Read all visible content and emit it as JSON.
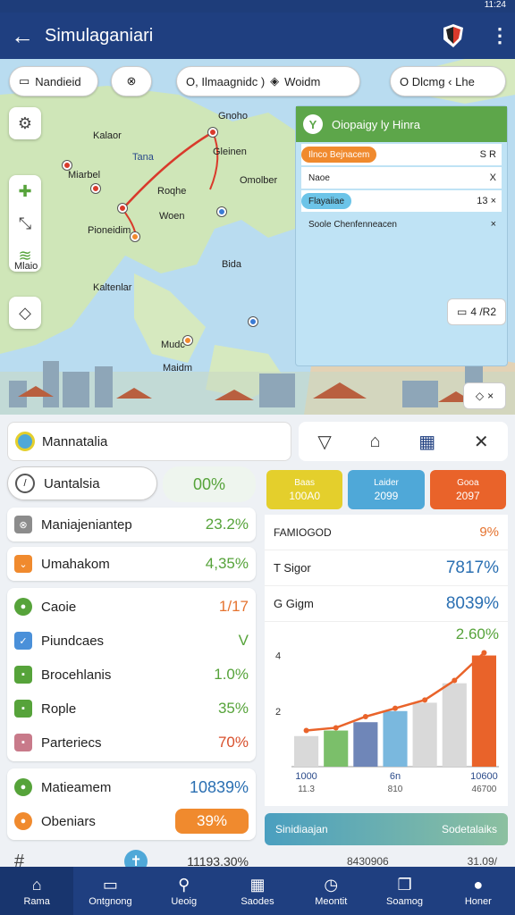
{
  "status": {
    "time": "11:24"
  },
  "appbar": {
    "title": "Simulaganiari"
  },
  "map": {
    "chips": [
      "Nandieid",
      "O, Ilmaagnidc  )",
      "Woidm",
      "O Dlcmg  ‹ Lhe"
    ],
    "labels": [
      "Kalaor",
      "Tana",
      "Gnoho",
      "Miarbel",
      "Gleinen",
      "Roqhe",
      "Omolber",
      "Woen",
      "Pioneidim",
      "Bida",
      "Mlaio",
      "Kaltenlar",
      "Mudc",
      "Maidm"
    ],
    "legend": {
      "title": "Oiopaigy ly Hinra",
      "rows": [
        {
          "tag": "Ilnco Bejnacem",
          "tag_color": "#f08a2e",
          "value": "S R"
        },
        {
          "tag": "Naoe",
          "tag_color": "#ffffff",
          "value": "X"
        },
        {
          "tag": "Flayaiiae",
          "tag_color": "#6cc4e8",
          "value": "13  ×"
        },
        {
          "tag": "Soole Chenfenneacen",
          "tag_color": "#bfe3f5",
          "value": "×"
        }
      ],
      "counter": "4 /R2"
    }
  },
  "toolbar": {
    "search_label": "Mannatalia"
  },
  "left": {
    "top": {
      "label": "Uantalsia",
      "value": "00%"
    },
    "rows": [
      {
        "label": "Maniajeniantep",
        "value": "23.2%",
        "color": "#56a33a",
        "icon_color": "#8c8c8c",
        "icon": "⊗"
      },
      {
        "label": "Umahakom",
        "value": "4,35%",
        "color": "#56a33a",
        "icon_color": "#f08a2e",
        "icon": "⌄"
      }
    ],
    "group": [
      {
        "label": "Caoie",
        "value": "1/17",
        "color": "#e5732f",
        "icon_color": "#56a33a",
        "icon": "●"
      },
      {
        "label": "Piundcaes",
        "value": "V",
        "color": "#56a33a",
        "icon_color": "#4a90d9",
        "icon": "✓"
      },
      {
        "label": "Brocehlanis",
        "value": "1.0%",
        "color": "#56a33a",
        "icon_color": "#56a33a",
        "icon": "▪"
      },
      {
        "label": "Rople",
        "value": "35%",
        "color": "#56a33a",
        "icon_color": "#56a33a",
        "icon": "▪"
      },
      {
        "label": "Parteriecs",
        "value": "70%",
        "color": "#d8502c",
        "icon_color": "#c87a8a",
        "icon": "▪"
      }
    ],
    "bottom": [
      {
        "label": "Matieamem",
        "value": "10839%",
        "color": "#2a6fb2",
        "icon_color": "#56a33a"
      },
      {
        "label": "Obeniars",
        "value": "39%",
        "color": "#ffffff",
        "icon_color": "#f08a2e"
      }
    ],
    "footer": {
      "value": "11193.30%"
    }
  },
  "right": {
    "tiles": [
      {
        "label": "Baas",
        "value": "100A0",
        "color": "#e4cf2c"
      },
      {
        "label": "Laider",
        "value": "2099",
        "color": "#4fa8d8"
      },
      {
        "label": "Gooa",
        "value": "2097",
        "color": "#e9632a"
      }
    ],
    "rows": [
      {
        "label": "FAMIOGOD",
        "value": "9%",
        "color": "#e5732f"
      },
      {
        "label": "T Sigor",
        "value": "7817%",
        "color": "#2a6fb2"
      },
      {
        "label": "G Gigm",
        "value": "8039%",
        "color": "#2a6fb2"
      }
    ],
    "chart_annotation": "2.60%",
    "footer_left": "8430906",
    "footer_right": "31.09/",
    "banner": {
      "left": "Sinidiaajan",
      "right": "Sodetalaiks"
    }
  },
  "chart_data": {
    "type": "bar",
    "categories": [
      "1000",
      "",
      "",
      "6n",
      "",
      "",
      "10600"
    ],
    "sub_labels": [
      "11.3",
      "",
      "",
      "810",
      "",
      "",
      "46700"
    ],
    "values": [
      1.1,
      1.3,
      1.6,
      2.0,
      2.3,
      3.0,
      4.0
    ],
    "colors": [
      "#d9d9d9",
      "#7bbf6a",
      "#6f86b8",
      "#7ab8de",
      "#d9d9d9",
      "#d9d9d9",
      "#e9632a"
    ],
    "line": [
      1.3,
      1.4,
      1.8,
      2.1,
      2.4,
      3.1,
      4.1
    ],
    "yticks": [
      2,
      4
    ],
    "ylim": [
      0,
      4.5
    ]
  },
  "nav": [
    "Rama",
    "Ontgnong",
    "Ueoig",
    "Saodes",
    "Meontit",
    "Soamog",
    "Honer"
  ]
}
